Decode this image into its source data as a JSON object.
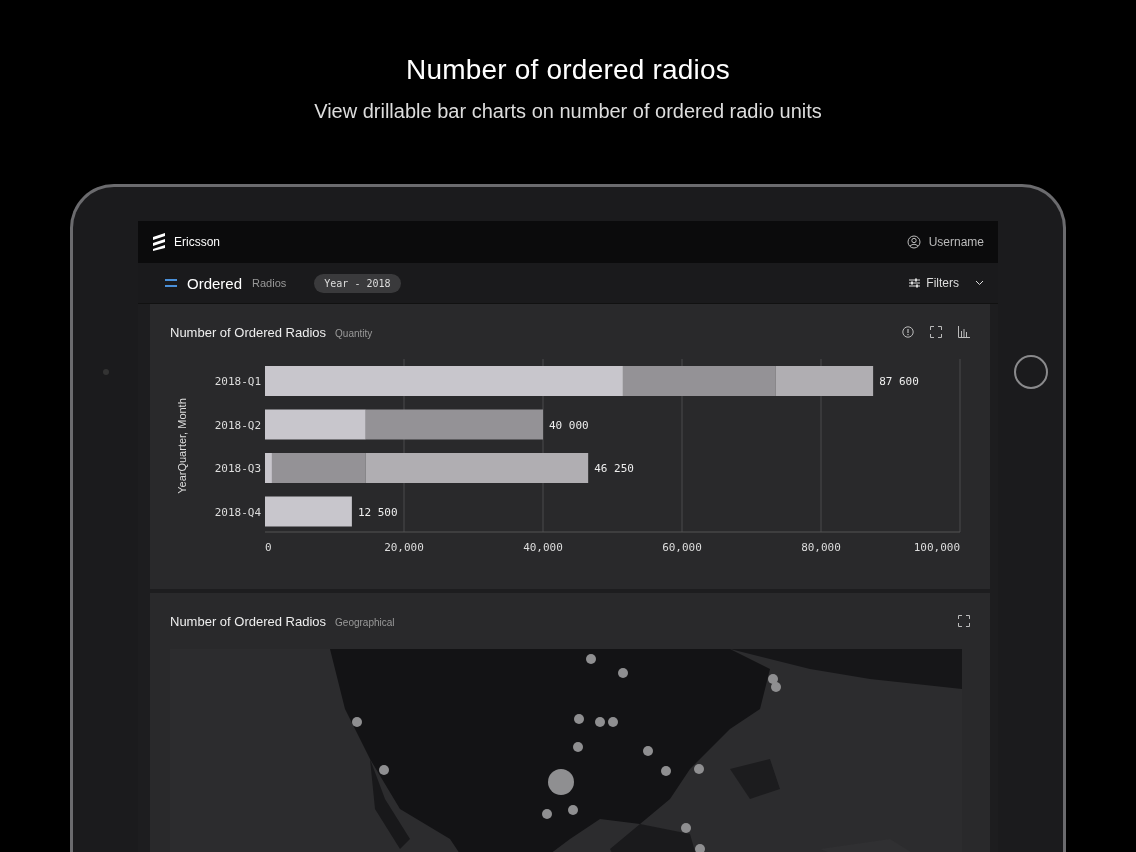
{
  "page": {
    "title": "Number of ordered radios",
    "subtitle": "View drillable bar charts on number of ordered radio units"
  },
  "app": {
    "brand": "Ericsson",
    "user": "Username"
  },
  "toolbar": {
    "title": "Ordered",
    "subtitle": "Radios",
    "filter_chip": "Year - 2018",
    "filters_label": "Filters"
  },
  "cards": [
    {
      "kind": "chart",
      "title": "Number of Ordered Radios",
      "subtitle": "Quantity",
      "chart_data": {
        "type": "bar",
        "orientation": "horizontal",
        "stacked": true,
        "ylabel": "YearQuarter, Month",
        "categories": [
          "2018-Q1",
          "2018-Q2",
          "2018-Q3",
          "2018-Q4"
        ],
        "series": [
          {
            "color": "#c8c6cc",
            "values": [
              51500,
              14500,
              1000,
              12500
            ]
          },
          {
            "color": "#949296",
            "values": [
              22000,
              25500,
              13500,
              null
            ]
          },
          {
            "color": "#b0aeb2",
            "values": [
              14000,
              null,
              32000,
              null
            ]
          }
        ],
        "grid": true,
        "xlim": [
          0,
          100000
        ],
        "xticks": [
          {
            "value": 0,
            "label": "0"
          },
          {
            "value": 20000,
            "label": "20,000"
          },
          {
            "value": 40000,
            "label": "40,000"
          },
          {
            "value": 60000,
            "label": "60,000"
          },
          {
            "value": 80000,
            "label": "80,000"
          },
          {
            "value": 100000,
            "label": "100,000"
          }
        ],
        "value_labels": [
          "87 600",
          "40 000",
          "46 250",
          "12 500"
        ]
      }
    },
    {
      "kind": "map",
      "title": "Number of Ordered Radios",
      "subtitle": "Geographical"
    }
  ]
}
